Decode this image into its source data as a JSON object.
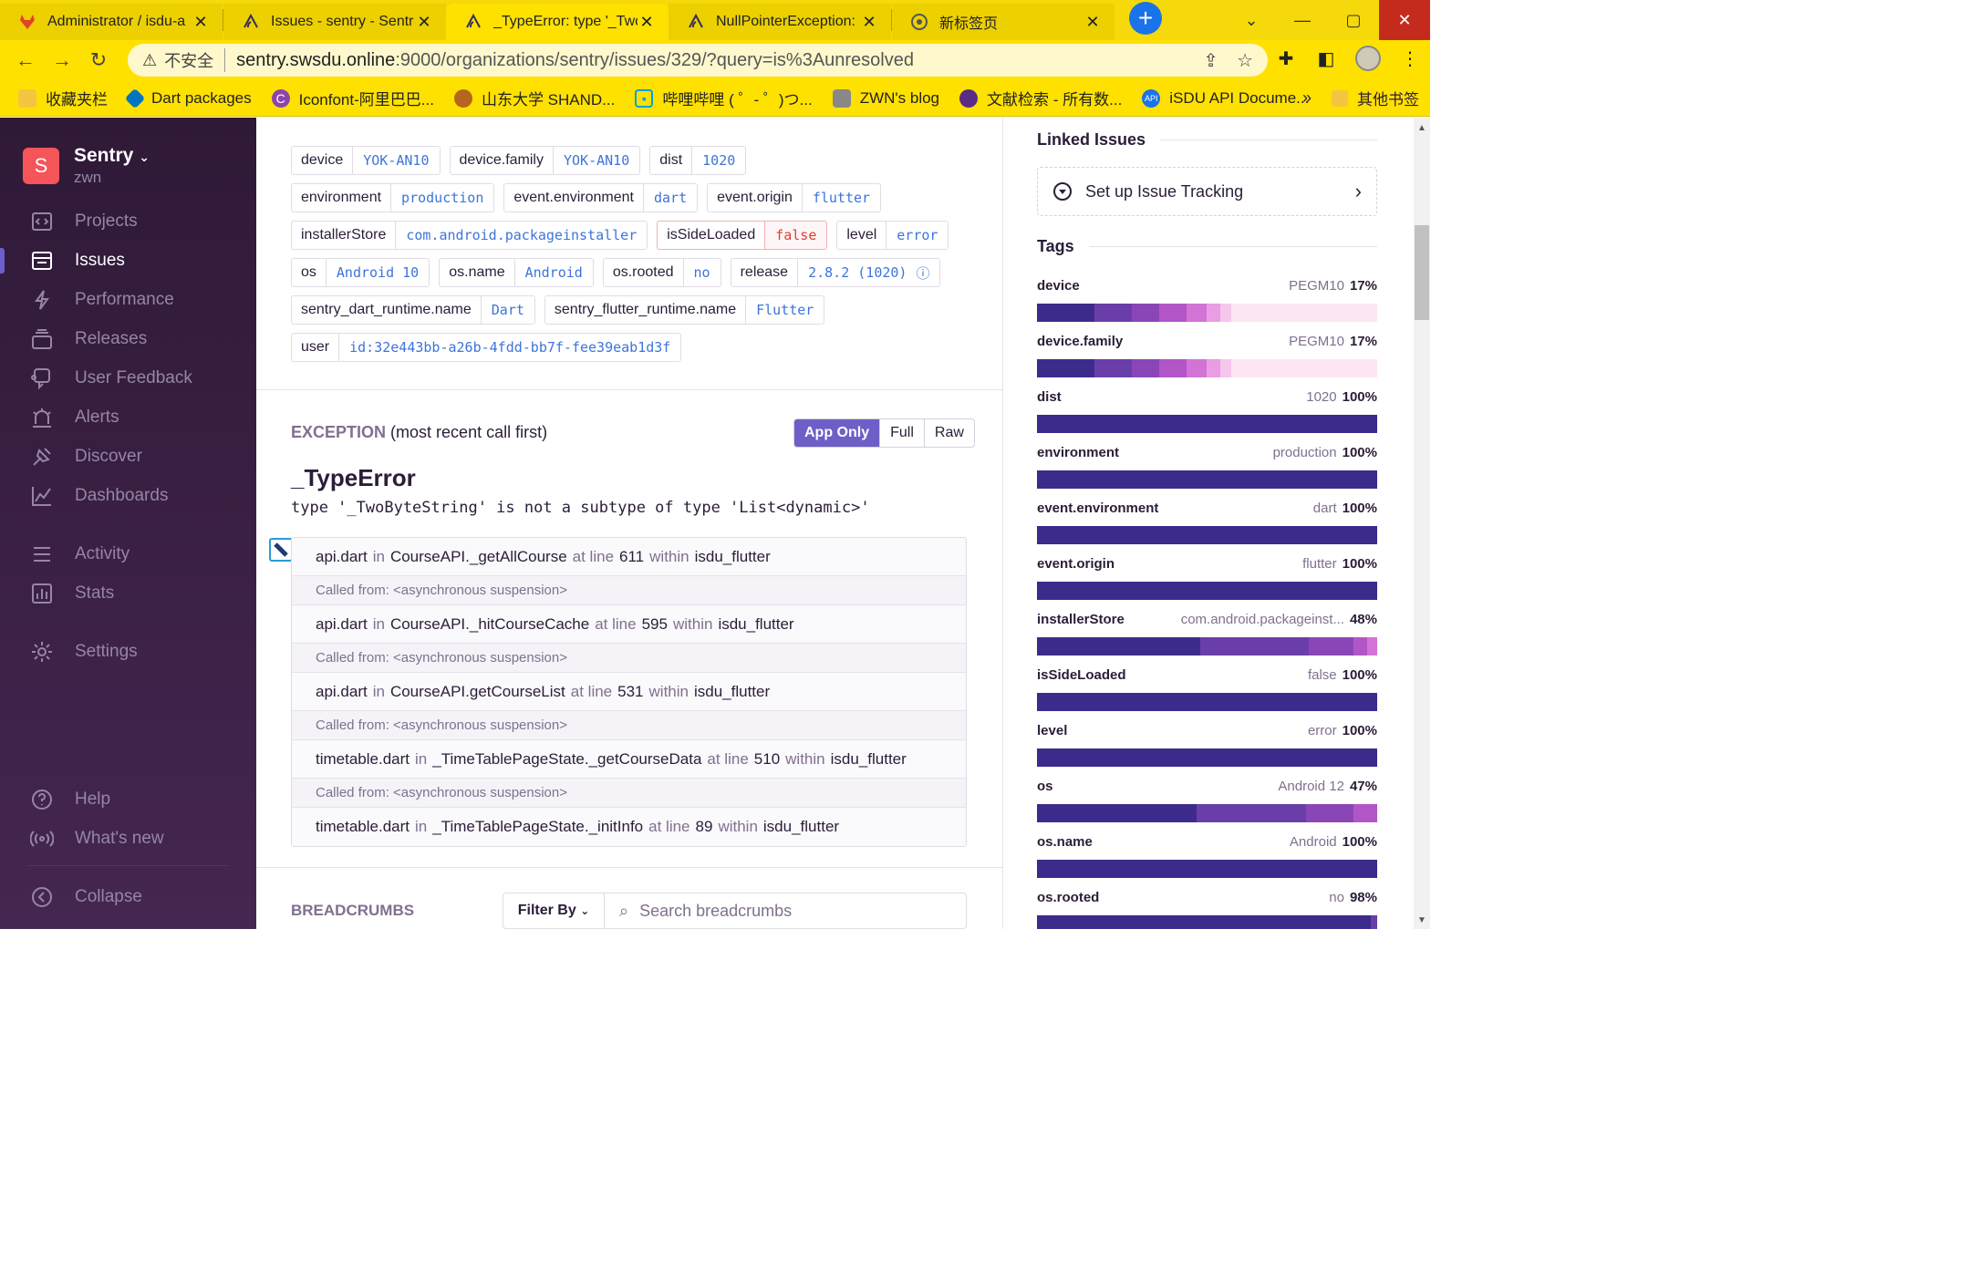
{
  "browser": {
    "tabs": [
      {
        "title": "Administrator / isdu-a",
        "icon": "gitlab-icon"
      },
      {
        "title": "Issues - sentry - Sentr",
        "icon": "sentry-icon"
      },
      {
        "title": "_TypeError: type '_Two",
        "icon": "sentry-icon",
        "active": true
      },
      {
        "title": "NullPointerException:",
        "icon": "sentry-icon"
      },
      {
        "title": "新标签页",
        "icon": "chrome-icon"
      }
    ],
    "insecure_label": "不安全",
    "url_host": "sentry.swsdu.online",
    "url_rest": ":9000/organizations/sentry/issues/329/?query=is%3Aunresolved",
    "bookmarks": [
      {
        "label": "收藏夹栏",
        "icon": "folder-icon"
      },
      {
        "label": "Dart packages",
        "icon": "dart-icon"
      },
      {
        "label": "Iconfont-阿里巴巴...",
        "icon": "iconfont-icon"
      },
      {
        "label": "山东大学 SHAND...",
        "icon": "sdu-icon"
      },
      {
        "label": "哔哩哔哩 ( ゜- ゜)つ...",
        "icon": "bilibili-icon"
      },
      {
        "label": "ZWN's blog",
        "icon": "blog-icon"
      },
      {
        "label": "文献检索 - 所有数...",
        "icon": "search-db-icon"
      },
      {
        "label": "iSDU API Docume...",
        "icon": "api-icon"
      }
    ],
    "bookmarks_more": "»",
    "other_bookmarks": "其他书签"
  },
  "sidebar": {
    "org_initial": "S",
    "org_name": "Sentry",
    "org_user": "zwn",
    "items": [
      {
        "label": "Projects",
        "icon": "projects-icon"
      },
      {
        "label": "Issues",
        "icon": "issues-icon",
        "active": true
      },
      {
        "label": "Performance",
        "icon": "performance-icon"
      },
      {
        "label": "Releases",
        "icon": "releases-icon"
      },
      {
        "label": "User Feedback",
        "icon": "user-feedback-icon"
      },
      {
        "label": "Alerts",
        "icon": "alerts-icon"
      },
      {
        "label": "Discover",
        "icon": "discover-icon"
      },
      {
        "label": "Dashboards",
        "icon": "dashboards-icon"
      },
      {
        "label": "Activity",
        "icon": "activity-icon"
      },
      {
        "label": "Stats",
        "icon": "stats-icon"
      },
      {
        "label": "Settings",
        "icon": "settings-icon"
      },
      {
        "label": "Help",
        "icon": "help-icon"
      },
      {
        "label": "What's new",
        "icon": "broadcast-icon"
      },
      {
        "label": "Collapse",
        "icon": "collapse-icon"
      }
    ]
  },
  "tags": [
    {
      "key": "device",
      "value": "YOK-AN10"
    },
    {
      "key": "device.family",
      "value": "YOK-AN10"
    },
    {
      "key": "dist",
      "value": "1020"
    },
    {
      "key": "environment",
      "value": "production"
    },
    {
      "key": "event.environment",
      "value": "dart"
    },
    {
      "key": "event.origin",
      "value": "flutter"
    },
    {
      "key": "installerStore",
      "value": "com.android.packageinstaller"
    },
    {
      "key": "isSideLoaded",
      "value": "false"
    },
    {
      "key": "level",
      "value": "error"
    },
    {
      "key": "os",
      "value": "Android 10"
    },
    {
      "key": "os.name",
      "value": "Android"
    },
    {
      "key": "os.rooted",
      "value": "no"
    },
    {
      "key": "release",
      "value": "2.8.2 (1020)"
    },
    {
      "key": "sentry_dart_runtime.name",
      "value": "Dart"
    },
    {
      "key": "sentry_flutter_runtime.name",
      "value": "Flutter"
    },
    {
      "key": "user",
      "value": "id:32e443bb-a26b-4fdd-bb7f-fee39eab1d3f"
    }
  ],
  "exception": {
    "heading": "EXCEPTION",
    "subheading": "(most recent call first)",
    "views": [
      "App Only",
      "Full",
      "Raw"
    ],
    "type": "_TypeError",
    "message": "type '_TwoByteString' is not a subtype of type 'List<dynamic>'",
    "in_word": "in",
    "at_line_word": "at line",
    "within_word": "within",
    "frames": [
      {
        "file": "api.dart",
        "fn": "CourseAPI._getAllCourse",
        "line": "611",
        "pkg": "isdu_flutter"
      },
      {
        "called": "Called from: <asynchronous suspension>"
      },
      {
        "file": "api.dart",
        "fn": "CourseAPI._hitCourseCache",
        "line": "595",
        "pkg": "isdu_flutter"
      },
      {
        "called": "Called from: <asynchronous suspension>"
      },
      {
        "file": "api.dart",
        "fn": "CourseAPI.getCourseList",
        "line": "531",
        "pkg": "isdu_flutter"
      },
      {
        "called": "Called from: <asynchronous suspension>"
      },
      {
        "file": "timetable.dart",
        "fn": "_TimeTablePageState._getCourseData",
        "line": "510",
        "pkg": "isdu_flutter"
      },
      {
        "called": "Called from: <asynchronous suspension>"
      },
      {
        "file": "timetable.dart",
        "fn": "_TimeTablePageState._initInfo",
        "line": "89",
        "pkg": "isdu_flutter"
      }
    ]
  },
  "breadcrumbs": {
    "heading": "BREADCRUMBS",
    "filter_label": "Filter By",
    "search_placeholder": "Search breadcrumbs"
  },
  "right": {
    "linked_heading": "Linked Issues",
    "tracking_label": "Set up Issue Tracking",
    "tags_heading": "Tags",
    "tag_stats": [
      {
        "key": "device",
        "top": "PEGM10",
        "pct": "17%",
        "segs": [
          0.17,
          0.11,
          0.08,
          0.08,
          0.06,
          0.04,
          0.03
        ]
      },
      {
        "key": "device.family",
        "top": "PEGM10",
        "pct": "17%",
        "segs": [
          0.17,
          0.11,
          0.08,
          0.08,
          0.06,
          0.04,
          0.03
        ]
      },
      {
        "key": "dist",
        "top": "1020",
        "pct": "100%",
        "segs": [
          1.0
        ]
      },
      {
        "key": "environment",
        "top": "production",
        "pct": "100%",
        "segs": [
          1.0
        ]
      },
      {
        "key": "event.environment",
        "top": "dart",
        "pct": "100%",
        "segs": [
          1.0
        ]
      },
      {
        "key": "event.origin",
        "top": "flutter",
        "pct": "100%",
        "segs": [
          1.0
        ]
      },
      {
        "key": "installerStore",
        "top": "com.android.packageinst...",
        "pct": "48%",
        "segs": [
          0.48,
          0.32,
          0.13,
          0.04,
          0.03
        ]
      },
      {
        "key": "isSideLoaded",
        "top": "false",
        "pct": "100%",
        "segs": [
          1.0
        ]
      },
      {
        "key": "level",
        "top": "error",
        "pct": "100%",
        "segs": [
          1.0
        ]
      },
      {
        "key": "os",
        "top": "Android 12",
        "pct": "47%",
        "segs": [
          0.47,
          0.32,
          0.14,
          0.07
        ]
      },
      {
        "key": "os.name",
        "top": "Android",
        "pct": "100%",
        "segs": [
          1.0
        ]
      },
      {
        "key": "os.rooted",
        "top": "no",
        "pct": "98%",
        "segs": [
          0.98,
          0.02
        ]
      }
    ],
    "bar_colors": [
      "#3d2b8c",
      "#6a3ea8",
      "#8a46b6",
      "#b256c7",
      "#d273d6",
      "#e99de2",
      "#f6c7ec"
    ]
  }
}
